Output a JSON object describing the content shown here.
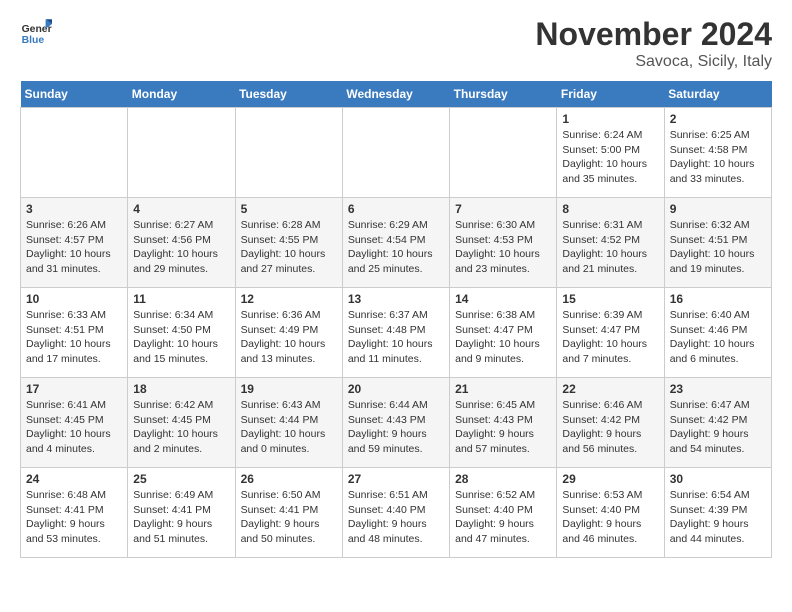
{
  "logo": {
    "general": "General",
    "blue": "Blue"
  },
  "title": "November 2024",
  "location": "Savoca, Sicily, Italy",
  "days_of_week": [
    "Sunday",
    "Monday",
    "Tuesday",
    "Wednesday",
    "Thursday",
    "Friday",
    "Saturday"
  ],
  "weeks": [
    [
      {
        "day": "",
        "info": ""
      },
      {
        "day": "",
        "info": ""
      },
      {
        "day": "",
        "info": ""
      },
      {
        "day": "",
        "info": ""
      },
      {
        "day": "",
        "info": ""
      },
      {
        "day": "1",
        "info": "Sunrise: 6:24 AM\nSunset: 5:00 PM\nDaylight: 10 hours and 35 minutes."
      },
      {
        "day": "2",
        "info": "Sunrise: 6:25 AM\nSunset: 4:58 PM\nDaylight: 10 hours and 33 minutes."
      }
    ],
    [
      {
        "day": "3",
        "info": "Sunrise: 6:26 AM\nSunset: 4:57 PM\nDaylight: 10 hours and 31 minutes."
      },
      {
        "day": "4",
        "info": "Sunrise: 6:27 AM\nSunset: 4:56 PM\nDaylight: 10 hours and 29 minutes."
      },
      {
        "day": "5",
        "info": "Sunrise: 6:28 AM\nSunset: 4:55 PM\nDaylight: 10 hours and 27 minutes."
      },
      {
        "day": "6",
        "info": "Sunrise: 6:29 AM\nSunset: 4:54 PM\nDaylight: 10 hours and 25 minutes."
      },
      {
        "day": "7",
        "info": "Sunrise: 6:30 AM\nSunset: 4:53 PM\nDaylight: 10 hours and 23 minutes."
      },
      {
        "day": "8",
        "info": "Sunrise: 6:31 AM\nSunset: 4:52 PM\nDaylight: 10 hours and 21 minutes."
      },
      {
        "day": "9",
        "info": "Sunrise: 6:32 AM\nSunset: 4:51 PM\nDaylight: 10 hours and 19 minutes."
      }
    ],
    [
      {
        "day": "10",
        "info": "Sunrise: 6:33 AM\nSunset: 4:51 PM\nDaylight: 10 hours and 17 minutes."
      },
      {
        "day": "11",
        "info": "Sunrise: 6:34 AM\nSunset: 4:50 PM\nDaylight: 10 hours and 15 minutes."
      },
      {
        "day": "12",
        "info": "Sunrise: 6:36 AM\nSunset: 4:49 PM\nDaylight: 10 hours and 13 minutes."
      },
      {
        "day": "13",
        "info": "Sunrise: 6:37 AM\nSunset: 4:48 PM\nDaylight: 10 hours and 11 minutes."
      },
      {
        "day": "14",
        "info": "Sunrise: 6:38 AM\nSunset: 4:47 PM\nDaylight: 10 hours and 9 minutes."
      },
      {
        "day": "15",
        "info": "Sunrise: 6:39 AM\nSunset: 4:47 PM\nDaylight: 10 hours and 7 minutes."
      },
      {
        "day": "16",
        "info": "Sunrise: 6:40 AM\nSunset: 4:46 PM\nDaylight: 10 hours and 6 minutes."
      }
    ],
    [
      {
        "day": "17",
        "info": "Sunrise: 6:41 AM\nSunset: 4:45 PM\nDaylight: 10 hours and 4 minutes."
      },
      {
        "day": "18",
        "info": "Sunrise: 6:42 AM\nSunset: 4:45 PM\nDaylight: 10 hours and 2 minutes."
      },
      {
        "day": "19",
        "info": "Sunrise: 6:43 AM\nSunset: 4:44 PM\nDaylight: 10 hours and 0 minutes."
      },
      {
        "day": "20",
        "info": "Sunrise: 6:44 AM\nSunset: 4:43 PM\nDaylight: 9 hours and 59 minutes."
      },
      {
        "day": "21",
        "info": "Sunrise: 6:45 AM\nSunset: 4:43 PM\nDaylight: 9 hours and 57 minutes."
      },
      {
        "day": "22",
        "info": "Sunrise: 6:46 AM\nSunset: 4:42 PM\nDaylight: 9 hours and 56 minutes."
      },
      {
        "day": "23",
        "info": "Sunrise: 6:47 AM\nSunset: 4:42 PM\nDaylight: 9 hours and 54 minutes."
      }
    ],
    [
      {
        "day": "24",
        "info": "Sunrise: 6:48 AM\nSunset: 4:41 PM\nDaylight: 9 hours and 53 minutes."
      },
      {
        "day": "25",
        "info": "Sunrise: 6:49 AM\nSunset: 4:41 PM\nDaylight: 9 hours and 51 minutes."
      },
      {
        "day": "26",
        "info": "Sunrise: 6:50 AM\nSunset: 4:41 PM\nDaylight: 9 hours and 50 minutes."
      },
      {
        "day": "27",
        "info": "Sunrise: 6:51 AM\nSunset: 4:40 PM\nDaylight: 9 hours and 48 minutes."
      },
      {
        "day": "28",
        "info": "Sunrise: 6:52 AM\nSunset: 4:40 PM\nDaylight: 9 hours and 47 minutes."
      },
      {
        "day": "29",
        "info": "Sunrise: 6:53 AM\nSunset: 4:40 PM\nDaylight: 9 hours and 46 minutes."
      },
      {
        "day": "30",
        "info": "Sunrise: 6:54 AM\nSunset: 4:39 PM\nDaylight: 9 hours and 44 minutes."
      }
    ]
  ]
}
